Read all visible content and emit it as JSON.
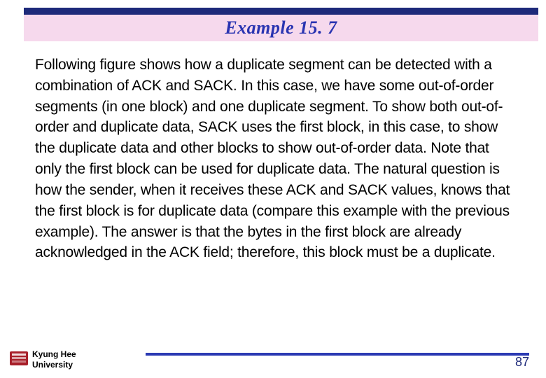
{
  "title": "Example 15. 7",
  "body": "Following figure shows how a duplicate segment can be detected with a combination of ACK and SACK. In this case, we have some out-of-order segments (in one block) and one duplicate segment. To show both out-of-order and duplicate data, SACK uses the first block, in this case, to show the duplicate data and other blocks to show out-of-order data. Note that only the first block can be used for duplicate data. The natural question is how the sender, when it receives these ACK and SACK values, knows that the first block is for duplicate data (compare this example with the previous example). The answer is that the bytes in the first block are already acknowledged in the ACK field; therefore, this block must be a duplicate.",
  "footer": {
    "university_line1": "Kyung Hee",
    "university_line2": "University",
    "page": "87"
  },
  "colors": {
    "brand_dark": "#1e2a7a",
    "brand_accent": "#2934b1",
    "title_band": "#f6d9ed",
    "logo_red": "#a8202a"
  }
}
